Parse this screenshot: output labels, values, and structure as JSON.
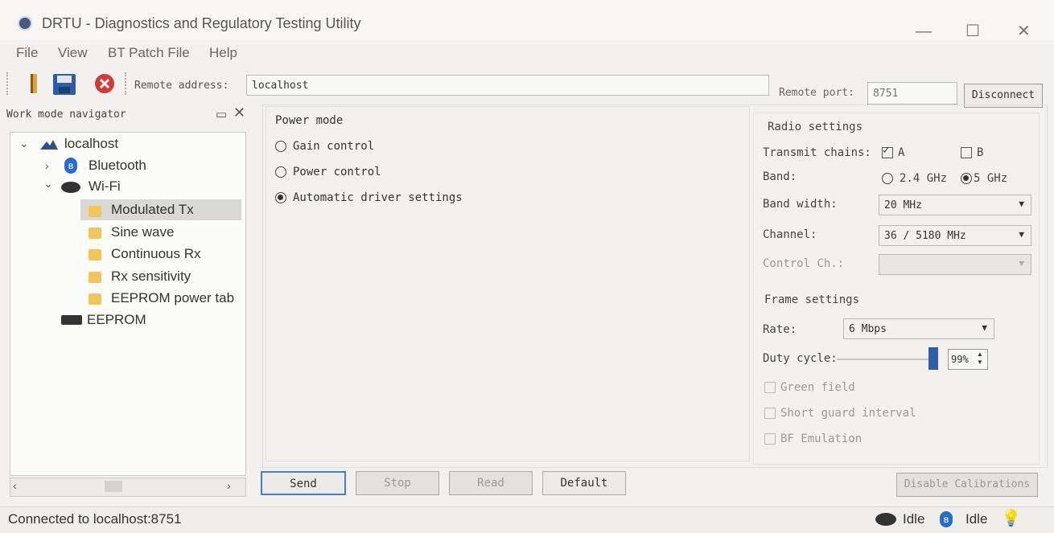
{
  "window": {
    "title": "DRTU - Diagnostics and Regulatory Testing Utility",
    "minimize": "—",
    "maximize": "☐",
    "close": "✕"
  },
  "menu": [
    "File",
    "View",
    "BT Patch File",
    "Help"
  ],
  "toolbar": {
    "remote_address_label": "Remote address:",
    "remote_address_value": "localhost",
    "remote_port_label": "Remote port:",
    "remote_port_value": "8751",
    "disconnect_label": "Disconnect"
  },
  "navigator": {
    "title": "Work mode navigator",
    "pin_icon": "restore-icon",
    "close_icon": "close-icon",
    "root": "localhost",
    "bluetooth": "Bluetooth",
    "wifi": "Wi-Fi",
    "wifi_items": [
      "Modulated Tx",
      "Sine wave",
      "Continuous Rx",
      "Rx sensitivity",
      "EEPROM power tab"
    ],
    "eeprom": "EEPROM",
    "selected": "Modulated Tx"
  },
  "power_mode": {
    "title": "Power mode",
    "options": [
      "Gain control",
      "Power control",
      "Automatic driver settings"
    ],
    "selected": "Automatic driver settings"
  },
  "radio_settings": {
    "title": "Radio settings",
    "transmit_chains_label": "Transmit chains:",
    "chain_a": "A",
    "chain_a_checked": true,
    "chain_b": "B",
    "chain_b_checked": false,
    "band_label": "Band:",
    "band_options": [
      "2.4 GHz",
      "5 GHz"
    ],
    "band_selected": "5 GHz",
    "bandwidth_label": "Band width:",
    "bandwidth_value": "20 MHz",
    "channel_label": "Channel:",
    "channel_value": "36 / 5180 MHz",
    "control_ch_label": "Control Ch.:",
    "control_ch_value": ""
  },
  "frame_settings": {
    "title": "Frame settings",
    "rate_label": "Rate:",
    "rate_value": "6 Mbps",
    "duty_cycle_label": "Duty cycle:",
    "duty_cycle_value": "99%",
    "duty_cycle_fraction": 0.99,
    "green_field": "Green field",
    "short_guard": "Short guard interval",
    "bf_emulation": "BF Emulation"
  },
  "buttons": {
    "send": "Send",
    "stop": "Stop",
    "read": "Read",
    "default": "Default",
    "disable_calibrations": "Disable Calibrations"
  },
  "status": {
    "connection": "Connected to localhost:8751",
    "wifi_state": "Idle",
    "bt_state": "Idle",
    "bt_glyph": "ʙ"
  },
  "colors": {
    "accent": "#4a7cc8",
    "slider": "#2e5fa8",
    "folder": "#f2c55a"
  }
}
